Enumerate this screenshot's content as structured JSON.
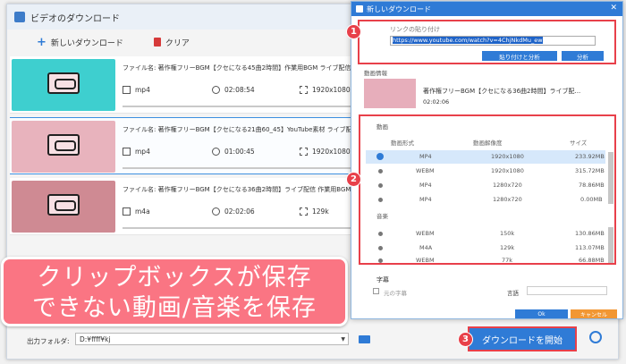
{
  "main": {
    "title": "ビデオのダウンロード",
    "new_download": "新しいダウンロード",
    "clear": "クリア",
    "videos": [
      {
        "filename": "ファイル名: 著作権フリーBGM【クセになる45曲2時間】作業用BGM ライブ配信 YouTube素材",
        "format": "mp4",
        "duration": "02:08:54",
        "resolution": "1920x1080",
        "thumb_color": "#3ecfcf"
      },
      {
        "filename": "ファイル名: 著作権フリーBGM【クセになる21曲60_45】YouTube素材 ライブ配信 作業用BGM",
        "format": "mp4",
        "duration": "01:00:45",
        "resolution": "1920x1080",
        "thumb_color": "#e8b3bd"
      },
      {
        "filename": "ファイル名: 著作権フリーBGM【クセになる36曲2時間】ライブ配信 作業用BGM 勉強用BGM",
        "format": "m4a",
        "duration": "02:02:06",
        "resolution": "129k",
        "thumb_color": "#cf8a93"
      }
    ],
    "output_label": "出力フォルダ:",
    "output_path": "D:¥ffff¥kj",
    "download_start": "ダウンロードを開始"
  },
  "banner": {
    "line1": "クリップボックスが保存",
    "line2": "できない動画/音楽を保存"
  },
  "dialog": {
    "title": "新しいダウンロード",
    "link_label": "リンクの貼り付け",
    "link_value": "https://www.youtube.com/watch?v=4ChjNkdMu_ew",
    "paste_analyze": "貼り付けと分析",
    "analyze": "分析",
    "video_info": "動画情報",
    "info_name": "著作権フリーBGM【クセになる36曲2時間】ライブ配...",
    "info_duration": "02:02:06",
    "video_section": "動画",
    "col_format": "動画形式",
    "col_resolution": "動画解像度",
    "col_size": "サイズ",
    "video_options": [
      {
        "format": "MP4",
        "resolution": "1920x1080",
        "size": "233.92MB",
        "selected": true
      },
      {
        "format": "WEBM",
        "resolution": "1920x1080",
        "size": "315.72MB",
        "selected": false
      },
      {
        "format": "MP4",
        "resolution": "1280x720",
        "size": "78.86MB",
        "selected": false
      },
      {
        "format": "MP4",
        "resolution": "1280x720",
        "size": "0.00MB",
        "selected": false
      }
    ],
    "audio_section": "音楽",
    "audio_options": [
      {
        "format": "WEBM",
        "bitrate": "150k",
        "size": "130.86MB"
      },
      {
        "format": "M4A",
        "bitrate": "129k",
        "size": "113.07MB"
      },
      {
        "format": "WEBM",
        "bitrate": "77k",
        "size": "66.88MB"
      }
    ],
    "subtitle_section": "字幕",
    "original_subtitle": "元の字幕",
    "language_label": "言語",
    "ok": "Ok",
    "cancel": "キャンセル"
  },
  "steps": [
    "1",
    "2",
    "3"
  ],
  "colors": {
    "accent": "#2f7bd6",
    "highlight": "#e8404a",
    "banner": "#fa7583",
    "cancel": "#f29733"
  }
}
